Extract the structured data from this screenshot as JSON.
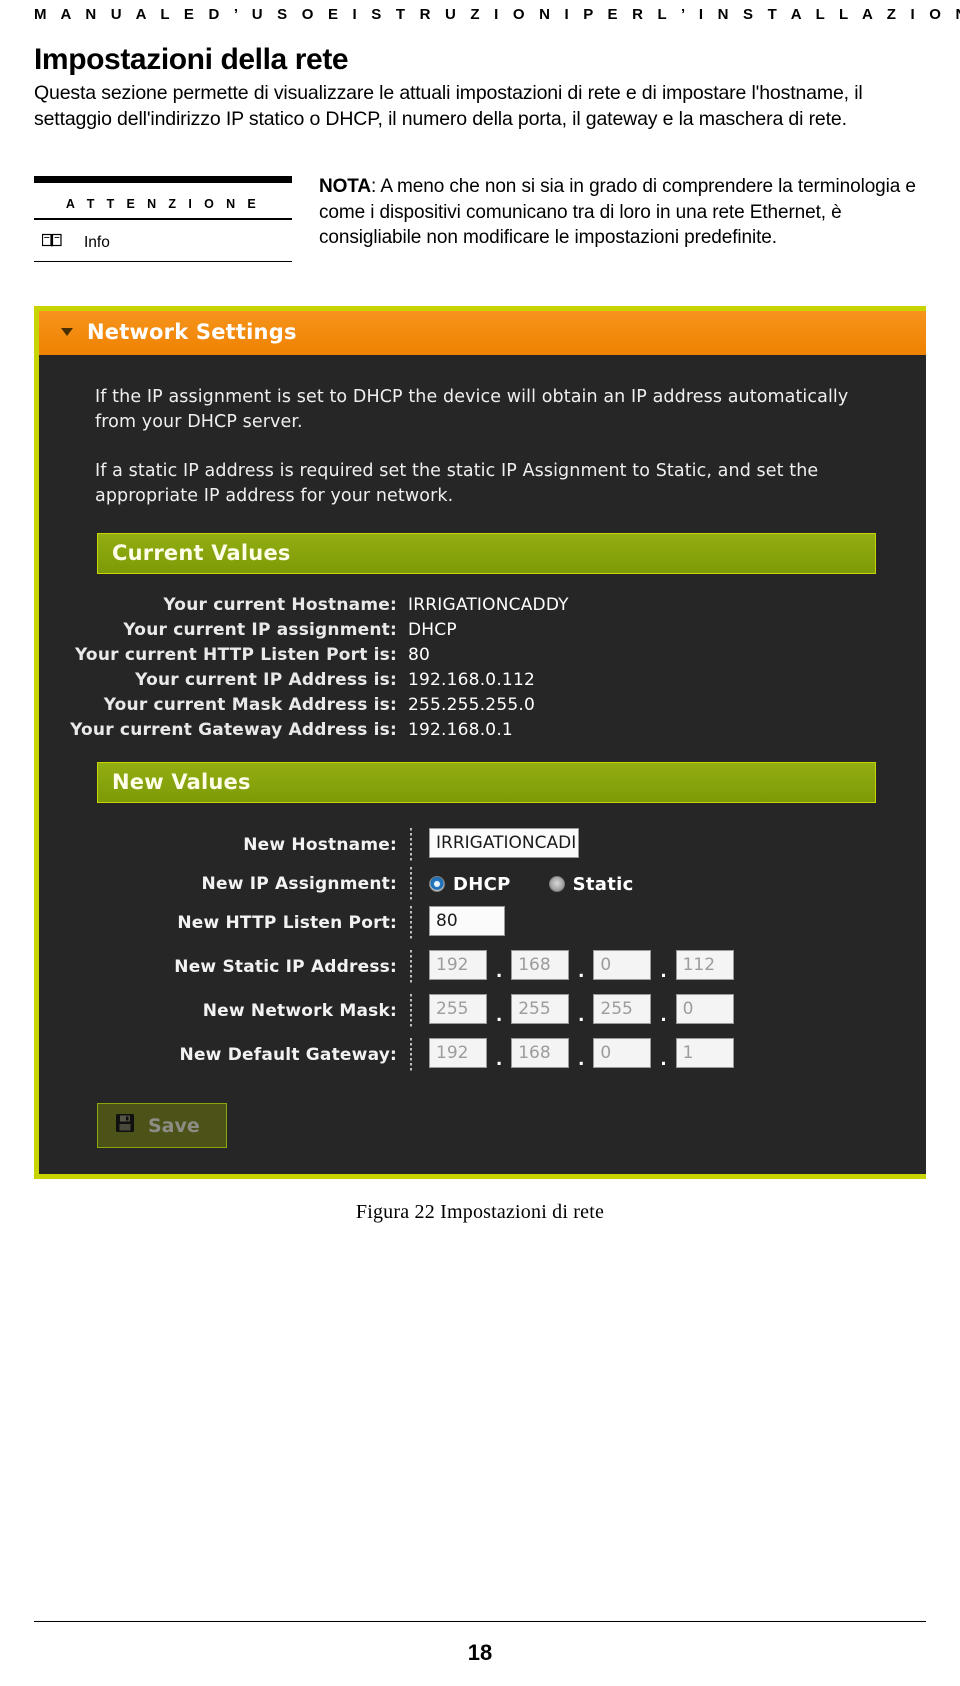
{
  "running_head": "M A N U A L E   D ’ U S O   E   I S T R U Z I O N I   P E R   L ’ I N S T A L L A Z I O N E",
  "title": "Impostazioni della rete",
  "intro": "Questa sezione permette di visualizzare le attuali impostazioni di rete e di impostare l'hostname, il settaggio dell'indirizzo IP statico o DHCP, il numero della porta, il gateway e la maschera di rete.",
  "attention": {
    "heading": "A T T E N Z I O N E",
    "info_label": "Info",
    "icon": "book-icon"
  },
  "note": {
    "label": "NOTA",
    "text": ": A meno che non si sia in grado di comprendere la terminologia e come i dispositivi comunicano tra di loro  in una rete Ethernet, è consigliabile non modificare le impostazioni predefinite."
  },
  "screenshot": {
    "panel_title": "Network Settings",
    "caret_icon": "chevron-down-icon",
    "paragraphs": [
      "If the IP assignment is set to DHCP the device will obtain an IP address automatically from your DHCP server.",
      "If a static IP address is required set the static IP Assignment to Static, and set the appropriate IP address for your network."
    ],
    "current_values": {
      "heading": "Current Values",
      "rows": [
        {
          "label": "Your current Hostname:",
          "value": "IRRIGATIONCADDY"
        },
        {
          "label": "Your current IP assignment:",
          "value": "DHCP"
        },
        {
          "label": "Your current HTTP Listen Port is:",
          "value": "80"
        },
        {
          "label": "Your current IP Address is:",
          "value": "192.168.0.112"
        },
        {
          "label": "Your current Mask Address is:",
          "value": "255.255.255.0"
        },
        {
          "label": "Your current Gateway Address is:",
          "value": "192.168.0.1"
        }
      ]
    },
    "new_values": {
      "heading": "New Values",
      "hostname": {
        "label": "New Hostname:",
        "value": "IRRIGATIONCADI"
      },
      "ip_assignment": {
        "label": "New IP Assignment:",
        "options": [
          "DHCP",
          "Static"
        ],
        "selected": "DHCP"
      },
      "http_port": {
        "label": "New HTTP Listen Port:",
        "value": "80"
      },
      "static_ip": {
        "label": "New Static IP Address:",
        "octets": [
          "192",
          "168",
          "0",
          "112"
        ]
      },
      "network_mask": {
        "label": "New Network Mask:",
        "octets": [
          "255",
          "255",
          "255",
          "0"
        ]
      },
      "default_gateway": {
        "label": "New Default Gateway:",
        "octets": [
          "192",
          "168",
          "0",
          "1"
        ]
      },
      "separator": ".",
      "save": {
        "label": "Save",
        "icon": "floppy-disk-icon"
      }
    },
    "colors": {
      "panel_bg": "#262626",
      "header_orange": "#ef8200",
      "accent_lime": "#c8d400",
      "section_olive": "#8aa60c",
      "radio_blue": "#1d6fb5"
    }
  },
  "figure_caption": "Figura 22 Impostazioni di rete",
  "page_number": "18"
}
